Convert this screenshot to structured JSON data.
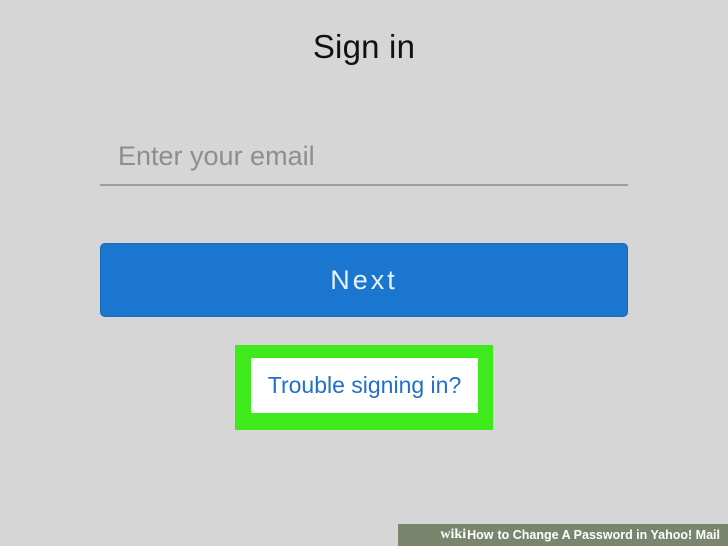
{
  "signin": {
    "title": "Sign in",
    "email_placeholder": "Enter your email",
    "email_value": "",
    "next_label": "Next",
    "trouble_link": "Trouble signing in?"
  },
  "highlight": {
    "color": "#3fea1c"
  },
  "colors": {
    "background": "#d6d6d6",
    "button_blue": "#1b76d0",
    "link_blue": "#1f6fcc"
  },
  "watermark": {
    "logo": "wiki",
    "how": "How",
    "text": "to Change A Password in Yahoo! Mail"
  }
}
